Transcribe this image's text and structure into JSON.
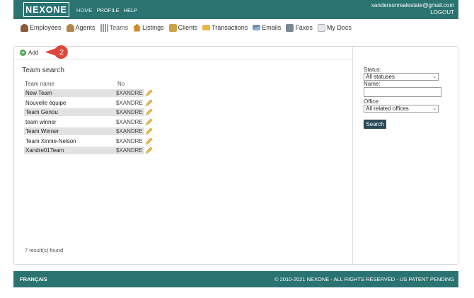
{
  "header": {
    "logo": "NEXONE",
    "nav": [
      "HOME",
      "PROFILE",
      "HELP"
    ],
    "user_email": "xandersonrealestate@gmail.com",
    "logout": "LOGOUT"
  },
  "menu": [
    {
      "label": "Employees",
      "icon": "employees-icon",
      "color": "#8a5a3b"
    },
    {
      "label": "Agents",
      "icon": "agents-icon",
      "color": "#b4884a"
    },
    {
      "label": "Teams",
      "icon": "teams-icon",
      "color": "#9a9a9a"
    },
    {
      "label": "Listings",
      "icon": "listings-icon",
      "color": "#d08a2e"
    },
    {
      "label": "Clients",
      "icon": "clients-icon",
      "color": "#c9a24a"
    },
    {
      "label": "Transactions",
      "icon": "folder-icon",
      "color": "#e8b64a"
    },
    {
      "label": "Emails",
      "icon": "email-icon",
      "color": "#6f8fb5"
    },
    {
      "label": "Faxes",
      "icon": "fax-icon",
      "color": "#7b8794"
    },
    {
      "label": "My Docs",
      "icon": "docs-icon",
      "color": "#aab0b8"
    }
  ],
  "toolbar": {
    "add_label": "Add",
    "callout_number": "2"
  },
  "team_search": {
    "title": "Team search",
    "col_name": "Team name",
    "col_no": "No",
    "rows": [
      {
        "name": "New Team",
        "no": "$XANDRE"
      },
      {
        "name": "Nouvelle équipe",
        "no": "$XANDRE"
      },
      {
        "name": "Team Genou",
        "no": "$XANDRE"
      },
      {
        "name": "team winner",
        "no": "$XANDRE"
      },
      {
        "name": "Team Winner",
        "no": "$XANDRE"
      },
      {
        "name": "Team Xinnie-Nelson",
        "no": "$XANDRE"
      },
      {
        "name": "Xandre01Team",
        "no": "$XANDRE"
      }
    ],
    "result_count": "7 result(s) found"
  },
  "filters": {
    "status_label": "Status:",
    "status_value": "All statuses",
    "name_label": "Name:",
    "name_value": "",
    "office_label": "Office:",
    "office_value": "All related offices",
    "search_button": "Search"
  },
  "footer": {
    "language": "FRANÇAIS",
    "copyright": "© 2010-2021 NEXONE - ALL RIGHTS RESERVED - US PATENT PENDING"
  },
  "colors": {
    "brand": "#2a7371",
    "callout": "#e0453c",
    "search_button": "#2b4a57"
  }
}
